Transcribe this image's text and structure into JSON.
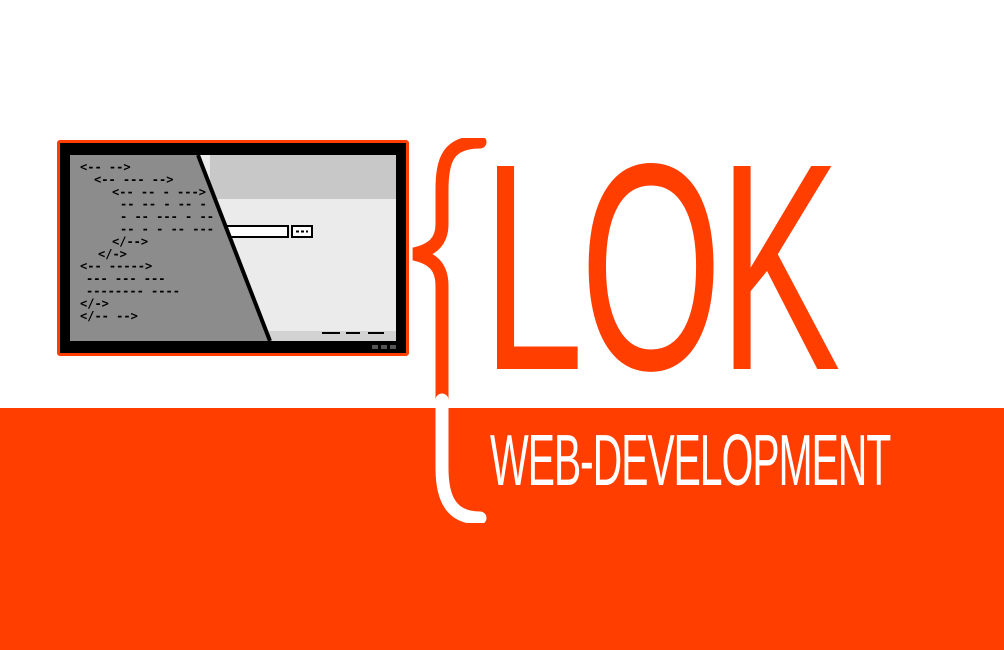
{
  "brand": {
    "name": "LOK",
    "tagline": "WEB-DEVELOPMENT",
    "open_brace": "{"
  },
  "colors": {
    "accent": "#ff3e00",
    "background": "#ffffff",
    "code_panel": "#8c8c8c",
    "preview_panel": "#ebebeb",
    "screen_bezel": "#000000"
  },
  "illustration": {
    "icon": "code-editor-monitor-icon",
    "code_lines": [
      "<-- -->",
      "<-- --- -->",
      "<-- -- - --->",
      "-- -- - -- -",
      "- -- --- - --",
      "-- - - -- ---",
      "</-->",
      "</->",
      "<-- ----->",
      "--- --- ---",
      "-------- ----",
      "</->",
      "</-- -->"
    ]
  }
}
